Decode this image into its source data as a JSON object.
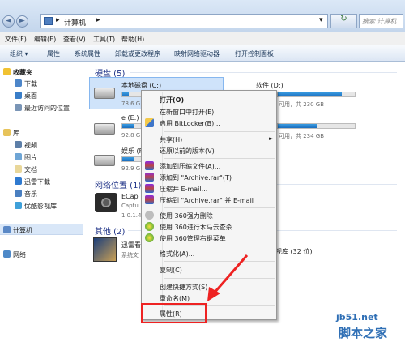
{
  "address": {
    "root_label": "计算机",
    "search_placeholder": "搜索 计算机",
    "refresh_glyph": "↻",
    "back_glyph": "◄",
    "forward_glyph": "►",
    "caret_glyph": "▾"
  },
  "menu": [
    "文件(F)",
    "编辑(E)",
    "查看(V)",
    "工具(T)",
    "帮助(H)"
  ],
  "toolbar": [
    "组织 ▾",
    "属性",
    "系统属性",
    "卸载或更改程序",
    "映射网络驱动器",
    "打开控制面板"
  ],
  "nav": {
    "favorites": "收藏夹",
    "fav_items": [
      "下载",
      "桌面",
      "最近访问的位置"
    ],
    "library": "库",
    "lib_items": [
      "视频",
      "图片",
      "文档",
      "迅雷下载",
      "音乐",
      "优酷影视库"
    ],
    "computer": "计算机",
    "network": "网络"
  },
  "content": {
    "hard_disks_header": "硬盘 (5)",
    "drives": [
      {
        "name": "本地磁盘 (C:)",
        "free": "78.6 G"
      },
      {
        "name": "e (E:)",
        "free": "92.8 G"
      },
      {
        "name": "娱乐 (F",
        "free": "92.9 G"
      },
      {
        "name": "软件 (D:)",
        "free": "可用，共 230 GB"
      },
      {
        "name": "",
        "free": "可用，共 234 GB"
      }
    ],
    "drive_fill": [
      0.33,
      0.6,
      0.6,
      0.83,
      0.5
    ],
    "net_header": "网络位置 (1)",
    "net_item": "ECap",
    "net_item_sub1": "Captu",
    "net_item_sub2": "1.0.1.4",
    "other_header": "其他 (2)",
    "other_item": "迅雷看",
    "other_item_sub": "系统文",
    "other_right": "视库 (32 位)"
  },
  "context_menu": {
    "items": [
      "打开(O)",
      "在新窗口中打开(E)",
      "启用 BitLocker(B)...",
      "共享(H)",
      "还原以前的版本(V)",
      "添加到压缩文件(A)...",
      "添加到 \"Archive.rar\"(T)",
      "压缩并 E-mail...",
      "压缩到 \"Archive.rar\" 并 E-mail",
      "使用 360强力删除",
      "使用 360进行木马云查杀",
      "使用 360管理右键菜单",
      "格式化(A)...",
      "复制(C)",
      "创建快捷方式(S)",
      "重命名(M)",
      "属性(R)"
    ],
    "submenu_arrow": "►"
  },
  "watermark": {
    "site": "jb51.net",
    "name": "脚本之家"
  }
}
